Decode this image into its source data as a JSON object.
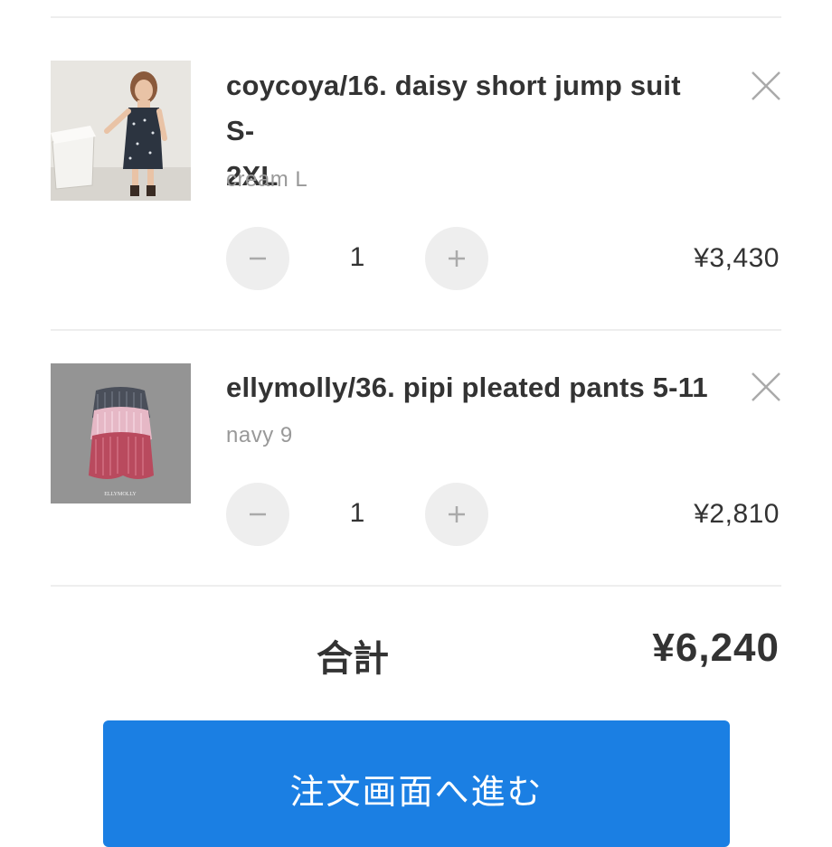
{
  "cart": {
    "items": [
      {
        "title_line1": "coycoya/16. daisy short jump suit S-",
        "title_line2": "2XL",
        "variant": "cream L",
        "quantity": "1",
        "price": "¥3,430",
        "image_icon": "product-photo-jumpsuit"
      },
      {
        "title_line1": "ellymolly/36. pipi pleated pants 5-11",
        "variant": "navy 9",
        "quantity": "1",
        "price": "¥2,810",
        "image_icon": "product-photo-pleated-pants",
        "image_caption": "ELLYMOLLY"
      }
    ],
    "controls": {
      "decrease_icon": "minus-icon",
      "increase_icon": "plus-icon",
      "remove_icon": "close-icon"
    }
  },
  "summary": {
    "total_label": "合計",
    "total_value": "¥6,240"
  },
  "checkout": {
    "label": "注文画面へ進む"
  },
  "colors": {
    "accent": "#1b7fe3",
    "text": "#333333",
    "muted": "#999999",
    "button_bg": "#eeeeee",
    "divider": "#eeeeee"
  }
}
